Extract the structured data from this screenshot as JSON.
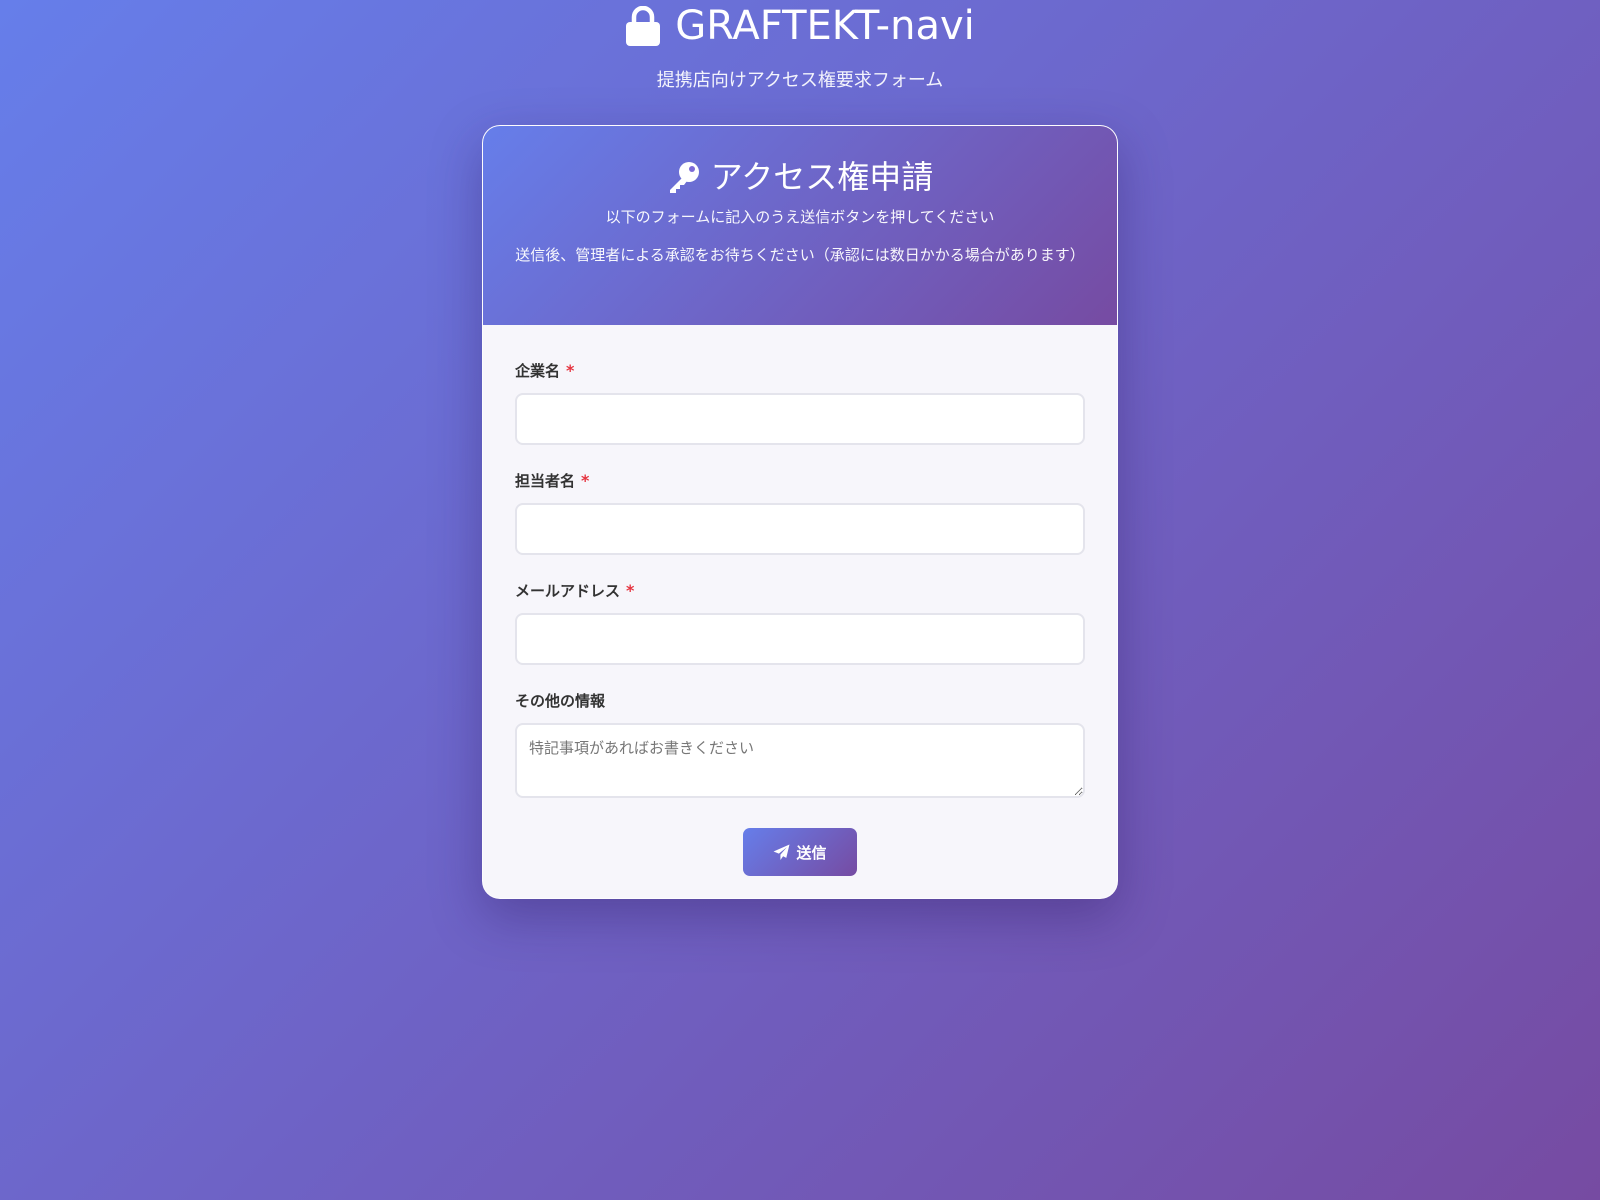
{
  "site": {
    "title": "GRAFTEKT-navi",
    "subtitle": "提携店向けアクセス権要求フォーム",
    "title_icon": "lock-icon"
  },
  "card": {
    "title": "アクセス権申請",
    "title_icon": "key-icon",
    "description": "以下のフォームに記入のうえ送信ボタンを押してください",
    "note": "送信後、管理者による承認をお待ちください（承認には数日かかる場合があります）"
  },
  "form": {
    "company": {
      "label": "企業名",
      "required_mark": "*",
      "value": ""
    },
    "contact": {
      "label": "担当者名",
      "required_mark": "*",
      "value": ""
    },
    "email": {
      "label": "メールアドレス",
      "required_mark": "*",
      "value": ""
    },
    "other": {
      "label": "その他の情報",
      "placeholder": "特記事項があればお書きください",
      "value": ""
    },
    "submit": {
      "label": "送信",
      "icon": "paper-plane-icon"
    }
  },
  "colors": {
    "gradient_start": "#667eea",
    "gradient_end": "#764ba2",
    "required": "#e5333f"
  }
}
